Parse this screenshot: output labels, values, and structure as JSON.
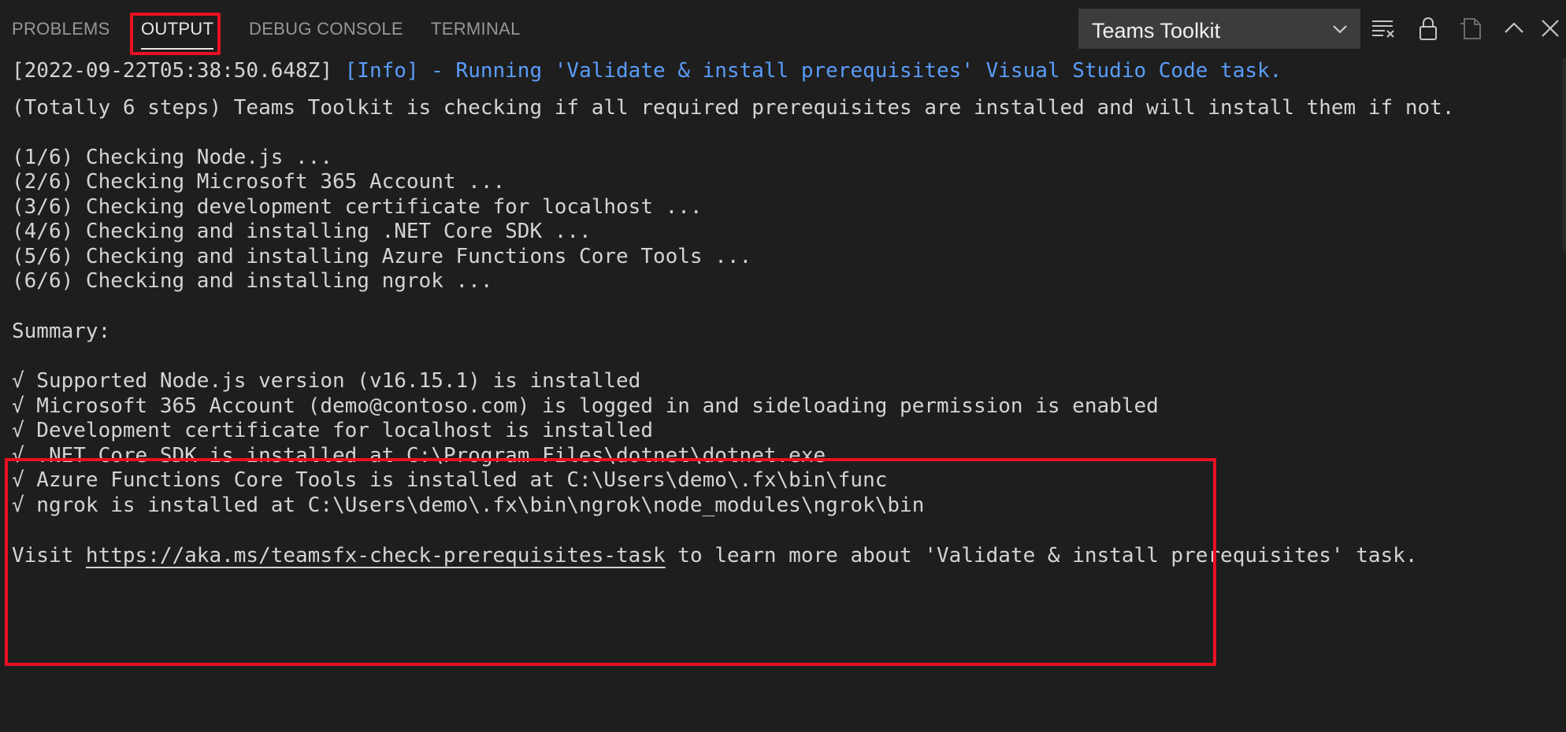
{
  "tabs": [
    {
      "label": "PROBLEMS",
      "active": false
    },
    {
      "label": "OUTPUT",
      "active": true
    },
    {
      "label": "DEBUG CONSOLE",
      "active": false
    },
    {
      "label": "TERMINAL",
      "active": false
    }
  ],
  "channel_select": {
    "selected": "Teams Toolkit"
  },
  "toolbar_icons": [
    "clear-output-icon",
    "lock-scroll-icon",
    "open-in-editor-icon",
    "maximize-panel-icon",
    "close-panel-icon"
  ],
  "output": {
    "timestamp": "[2022-09-22T05:38:50.648Z]",
    "info_text": "[Info] - Running 'Validate & install prerequisites' Visual Studio Code task.",
    "intro": "(Totally 6 steps) Teams Toolkit is checking if all required prerequisites are installed and will install them if not.",
    "steps": [
      "(1/6) Checking Node.js ...",
      "(2/6) Checking Microsoft 365 Account ...",
      "(3/6) Checking development certificate for localhost ...",
      "(4/6) Checking and installing .NET Core SDK ...",
      "(5/6) Checking and installing Azure Functions Core Tools ...",
      "(6/6) Checking and installing ngrok ..."
    ],
    "summary_label": "Summary:",
    "summary_items": [
      "√ Supported Node.js version (v16.15.1) is installed",
      "√ Microsoft 365 Account (demo@contoso.com) is logged in and sideloading permission is enabled",
      "√ Development certificate for localhost is installed",
      "√ .NET Core SDK is installed at C:\\Program Files\\dotnet\\dotnet.exe",
      "√ Azure Functions Core Tools is installed at C:\\Users\\demo\\.fx\\bin\\func",
      "√ ngrok is installed at C:\\Users\\demo\\.fx\\bin\\ngrok\\node_modules\\ngrok\\bin"
    ],
    "visit_prefix": "Visit ",
    "visit_link": "https://aka.ms/teamsfx-check-prerequisites-task",
    "visit_suffix": " to learn more about 'Validate & install prerequisites' task."
  },
  "colors": {
    "background": "#1e1e1e",
    "info": "#5a9cf8",
    "highlight_border": "#e81123"
  }
}
